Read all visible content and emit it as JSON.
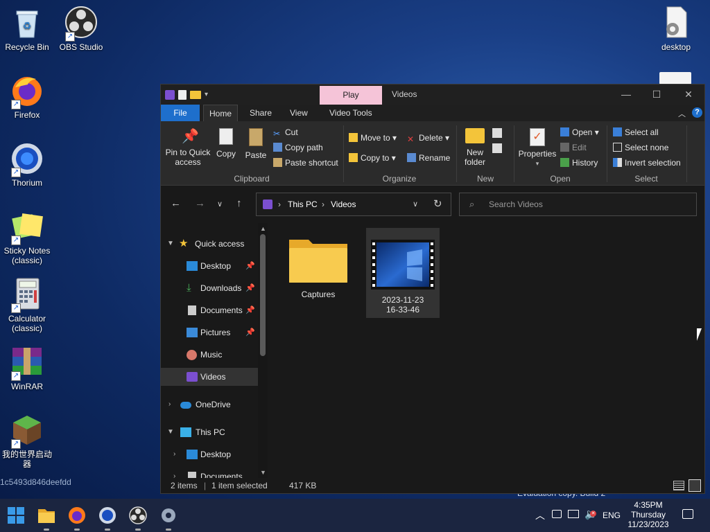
{
  "desktop": {
    "icons": [
      {
        "label": "Recycle Bin"
      },
      {
        "label": "OBS Studio"
      },
      {
        "label": "Firefox"
      },
      {
        "label": "Thorium"
      },
      {
        "label": "Sticky Notes (classic)"
      },
      {
        "label": "Calculator (classic)"
      },
      {
        "label": "WinRAR"
      },
      {
        "label": "我的世界启动器"
      },
      {
        "label": "desktop"
      }
    ],
    "watermark": "1c5493d846deefdd",
    "eval_copy": "Evaluation copy. Build 2"
  },
  "window": {
    "context_tab": "Play",
    "title": "Videos",
    "controls": {
      "minimize": "—",
      "maximize": "☐",
      "close": "✕"
    },
    "tabs": [
      "File",
      "Home",
      "Share",
      "View",
      "Video Tools"
    ],
    "ribbon": {
      "clipboard": {
        "pin": "Pin to Quick access",
        "copy": "Copy",
        "paste": "Paste",
        "cut": "Cut",
        "copy_path": "Copy path",
        "paste_shortcut": "Paste shortcut",
        "label": "Clipboard"
      },
      "organize": {
        "move_to": "Move to",
        "copy_to": "Copy to",
        "delete": "Delete",
        "rename": "Rename",
        "label": "Organize"
      },
      "new": {
        "new_folder": "New folder",
        "label": "New"
      },
      "open": {
        "properties": "Properties",
        "open": "Open",
        "edit": "Edit",
        "history": "History",
        "label": "Open"
      },
      "select": {
        "select_all": "Select all",
        "select_none": "Select none",
        "invert": "Invert selection",
        "label": "Select"
      }
    },
    "address": {
      "root": "This PC",
      "folder": "Videos"
    },
    "search_placeholder": "Search Videos",
    "nav": {
      "quick_access": "Quick access",
      "items": [
        {
          "label": "Desktop",
          "pinned": true
        },
        {
          "label": "Downloads",
          "pinned": true
        },
        {
          "label": "Documents",
          "pinned": true
        },
        {
          "label": "Pictures",
          "pinned": true
        },
        {
          "label": "Music",
          "pinned": false
        },
        {
          "label": "Videos",
          "pinned": false
        }
      ],
      "onedrive": "OneDrive",
      "this_pc": "This PC",
      "this_pc_children": [
        "Desktop",
        "Documents"
      ]
    },
    "content": {
      "items": [
        {
          "name": "Captures",
          "type": "folder"
        },
        {
          "name": "2023-11-23 16-33-46",
          "type": "video"
        }
      ]
    },
    "status": {
      "count": "2 items",
      "selection": "1 item selected",
      "size": "417 KB"
    }
  },
  "taskbar": {
    "tray": {
      "language": "ENG",
      "time": "4:35PM",
      "day": "Thursday",
      "date": "11/23/2023"
    }
  }
}
